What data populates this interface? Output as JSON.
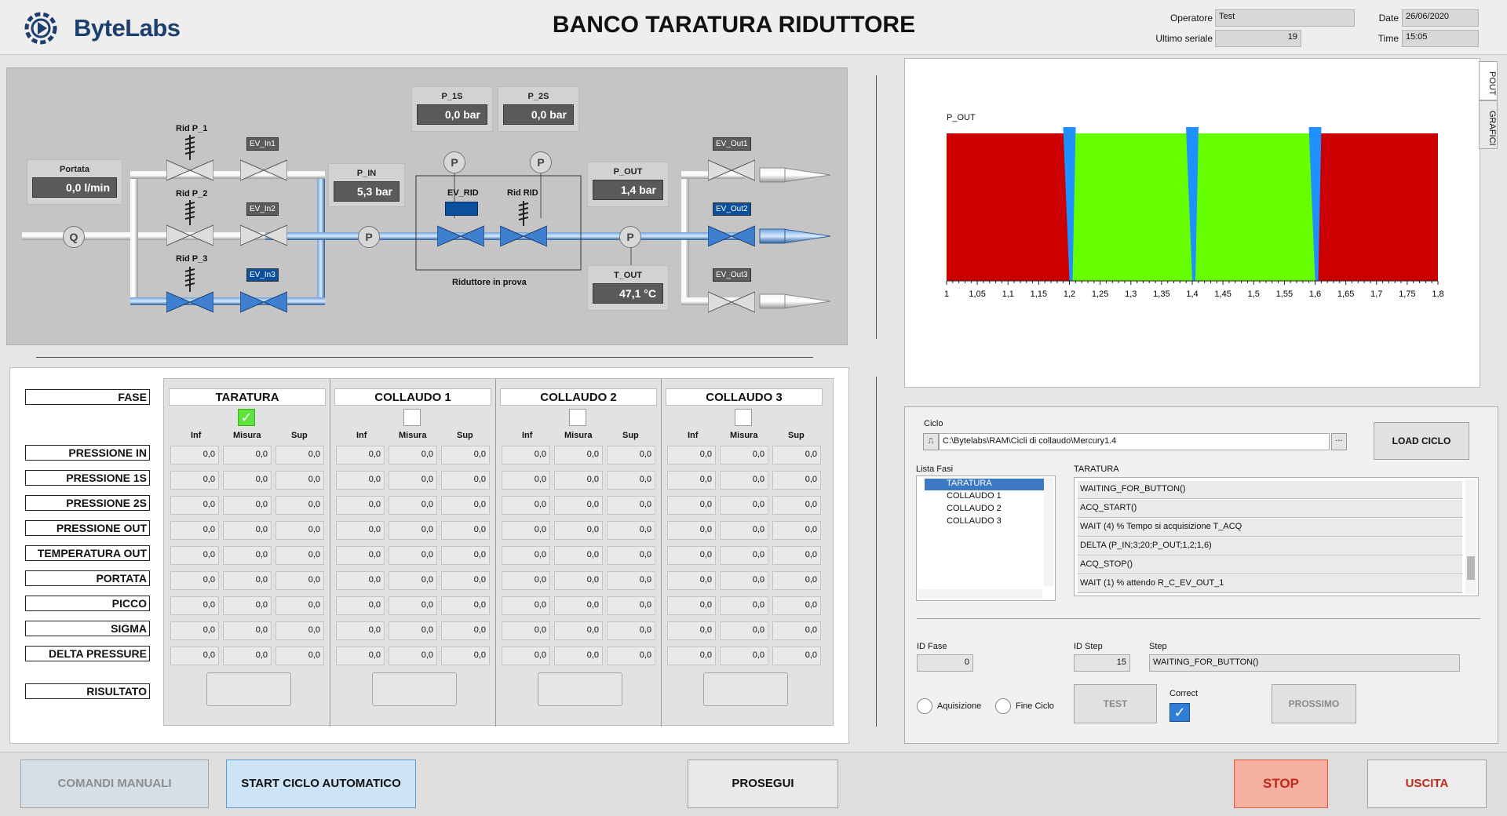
{
  "header": {
    "logo_text": "ByteLabs",
    "title": "BANCO TARATURA RIDUTTORE",
    "operatore_label": "Operatore",
    "operatore_value": "Test",
    "ultimo_seriale_label": "Ultimo seriale",
    "ultimo_seriale_value": "19",
    "date_label": "Date",
    "date_value": "26/06/2020",
    "time_label": "Time",
    "time_value": "15:05"
  },
  "process": {
    "portata": {
      "label": "Portata",
      "value": "0,0 l/min"
    },
    "p_in": {
      "label": "P_IN",
      "value": "5,3 bar"
    },
    "p_1s": {
      "label": "P_1S",
      "value": "0,0 bar"
    },
    "p_2s": {
      "label": "P_2S",
      "value": "0,0 bar"
    },
    "p_out": {
      "label": "P_OUT",
      "value": "1,4 bar"
    },
    "t_out": {
      "label": "T_OUT",
      "value": "47,1 °C"
    },
    "rid_p1": "Rid P_1",
    "rid_p2": "Rid P_2",
    "rid_p3": "Rid P_3",
    "ev_in1": "EV_In1",
    "ev_in2": "EV_In2",
    "ev_in3": "EV_In3",
    "ev_rid": "EV_RID",
    "rid_rid": "Rid RID",
    "ev_out1": "EV_Out1",
    "ev_out2": "EV_Out2",
    "ev_out3": "EV_Out3",
    "riduttore_label": "Riduttore in prova",
    "sensor_q": "Q",
    "sensor_p": "P",
    "active_color": "#0c4f9c"
  },
  "chart_tabs": [
    "POUT",
    "GRAFICI"
  ],
  "chart_data": {
    "type": "area",
    "title": "P_OUT",
    "xlim": [
      1,
      1.8
    ],
    "x_ticks": [
      "1",
      "1,05",
      "1,1",
      "1,15",
      "1,2",
      "1,25",
      "1,3",
      "1,35",
      "1,4",
      "1,45",
      "1,5",
      "1,55",
      "1,6",
      "1,65",
      "1,7",
      "1,75",
      "1,8"
    ],
    "bands": [
      {
        "from": 1.0,
        "to": 1.2,
        "color": "#cc0000"
      },
      {
        "from": 1.2,
        "to": 1.4,
        "color": "#66ff00"
      },
      {
        "from": 1.4,
        "to": 1.6,
        "color": "#66ff00"
      },
      {
        "from": 1.6,
        "to": 1.8,
        "color": "#cc0000"
      }
    ],
    "markers": [
      1.2,
      1.4,
      1.6
    ],
    "marker_color": "#1e90ff"
  },
  "table": {
    "row_labels": [
      "FASE",
      "PRESSIONE IN",
      "PRESSIONE 1S",
      "PRESSIONE 2S",
      "PRESSIONE OUT",
      "TEMPERATURA OUT",
      "PORTATA",
      "PICCO",
      "SIGMA",
      "DELTA PRESSURE",
      "RISULTATO"
    ],
    "sub_headers": [
      "Inf",
      "Misura",
      "Sup"
    ],
    "columns": [
      {
        "title": "TARATURA",
        "checked": true
      },
      {
        "title": "COLLAUDO 1",
        "checked": false
      },
      {
        "title": "COLLAUDO 2",
        "checked": false
      },
      {
        "title": "COLLAUDO 3",
        "checked": false
      }
    ],
    "cell_value": "0,0",
    "check_mark": "✓"
  },
  "control": {
    "ciclo_label": "Ciclo",
    "ciclo_path": "C:\\Bytelabs\\RAM\\Cicli di collaudo\\Mercury1.4",
    "browse_label": "...",
    "load_button": "LOAD CICLO",
    "lista_fasi_label": "Lista Fasi",
    "fasi": [
      "TARATURA",
      "COLLAUDO 1",
      "COLLAUDO 2",
      "COLLAUDO 3"
    ],
    "steps_label": "TARATURA",
    "steps": [
      "WAITING_FOR_BUTTON()",
      "ACQ_START()",
      "WAIT (4) % Tempo si acquisizione T_ACQ",
      "DELTA (P_IN;3;20;P_OUT;1,2;1,6)",
      "ACQ_STOP()",
      "WAIT (1) % attendo R_C_EV_OUT_1"
    ],
    "id_fase_label": "ID Fase",
    "id_fase_value": "0",
    "id_step_label": "ID Step",
    "id_step_value": "15",
    "step_label": "Step",
    "step_value": "WAITING_FOR_BUTTON()",
    "aquisizione_label": "Aquisizione",
    "fine_ciclo_label": "Fine Ciclo",
    "test_button": "TEST",
    "correct_label": "Correct",
    "prossimo_button": "PROSSIMO"
  },
  "bottom": {
    "comandi_manuali": "COMANDI MANUALI",
    "start_ciclo": "START CICLO AUTOMATICO",
    "prosegui": "PROSEGUI",
    "stop": "STOP",
    "uscita": "USCITA"
  }
}
